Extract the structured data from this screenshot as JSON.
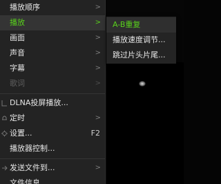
{
  "main_menu": {
    "items": [
      {
        "label": "播放顺序",
        "has_submenu": true
      },
      {
        "label": "播放",
        "has_submenu": true,
        "active": true
      },
      {
        "label": "画面",
        "has_submenu": true
      },
      {
        "label": "声音",
        "has_submenu": true
      },
      {
        "label": "字幕",
        "has_submenu": true
      },
      {
        "label": "歌词",
        "has_submenu": true,
        "disabled": true
      },
      {
        "label": "DLNA投屏播放...",
        "icon": "cast-icon"
      },
      {
        "label": "定时",
        "has_submenu": true,
        "icon": "bell-icon"
      },
      {
        "label": "设置...",
        "shortcut": "F2",
        "icon": "gear-icon"
      },
      {
        "label": "播放器控制..."
      },
      {
        "label": "发送文件到...",
        "has_submenu": true,
        "icon": "send-icon"
      },
      {
        "label": "文件信息"
      }
    ]
  },
  "playback_submenu": {
    "items": [
      {
        "label": "A-B重复",
        "active": true
      },
      {
        "label": "播放速度调节..."
      },
      {
        "label": "跳过片头片尾..."
      }
    ]
  },
  "colors": {
    "accent": "#59d11c",
    "menu_bg": "#232323",
    "text": "#e6e6e6",
    "disabled_text": "#5f5f5f"
  }
}
